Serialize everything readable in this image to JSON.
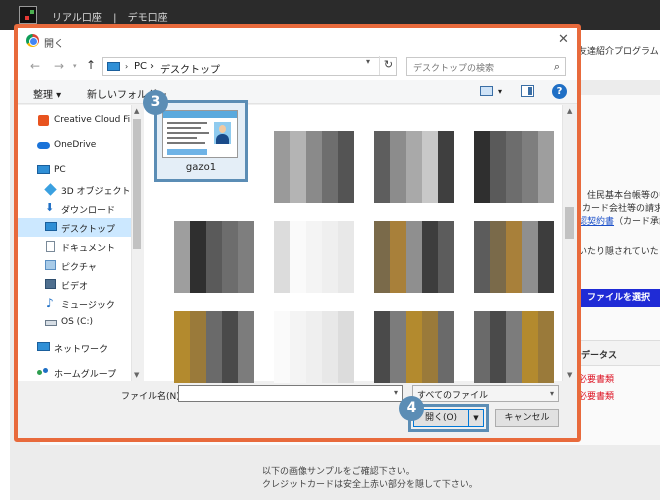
{
  "site": {
    "nav": [
      "リアル口座",
      "|",
      "デモ口座"
    ],
    "right_text_1": "友達紹介プログラム",
    "right_text_2": "、住民基本台帳等の中",
    "right_text_3": "カード会社等の請求書",
    "right_link": "認契約書",
    "right_text_4": "（カード承認",
    "right_text_5": "いたり隠されていたり",
    "upload_button": "ファイルを選択",
    "table_header": "データス",
    "required_1": "必要書類",
    "required_2": "必要書類",
    "bottom_line_1": "以下の画像サンプルをご確認下さい。",
    "bottom_line_2": "クレジットカードは安全上赤い部分を隠して下さい。"
  },
  "dialog": {
    "title": "開く",
    "breadcrumb": [
      "PC",
      "›",
      "デスクトップ"
    ],
    "search_placeholder": "デスクトップの検索",
    "toolbar": {
      "organize": "整理 ▾",
      "new_folder": "新しいフォルダー"
    },
    "nav_tree": [
      {
        "label": "Creative Cloud File",
        "icon": "creative-cloud-icon",
        "color": "#e8531f"
      },
      {
        "label": "OneDrive",
        "icon": "onedrive-icon",
        "color": "#1a73d9"
      },
      {
        "label": "PC",
        "icon": "pc-icon",
        "color": "#2f8fd6"
      },
      {
        "label": "3D オブジェクト",
        "icon": "3d-objects-icon",
        "color": "#3aa0e0"
      },
      {
        "label": "ダウンロード",
        "icon": "download-icon",
        "color": "#1f6fc5"
      },
      {
        "label": "デスクトップ",
        "icon": "desktop-icon",
        "color": "#2f8fd6",
        "selected": true
      },
      {
        "label": "ドキュメント",
        "icon": "documents-icon",
        "color": "#7a8a99"
      },
      {
        "label": "ピクチャ",
        "icon": "pictures-icon",
        "color": "#5a8fc2"
      },
      {
        "label": "ビデオ",
        "icon": "videos-icon",
        "color": "#4f6f8f"
      },
      {
        "label": "ミュージック",
        "icon": "music-icon",
        "color": "#1f6fc5"
      },
      {
        "label": "OS (C:)",
        "icon": "drive-icon",
        "color": "#6a7a8a"
      },
      {
        "label": "ネットワーク",
        "icon": "network-icon",
        "color": "#2f8fd6"
      },
      {
        "label": "ホームグループ",
        "icon": "homegroup-icon",
        "color": "#2e9e4f"
      }
    ],
    "selected_file": "gazo1",
    "file_name_label": "ファイル名(N):",
    "file_name_value": "",
    "file_type": "すべてのファイル",
    "open_button": "開く(O)",
    "cancel_button": "キャンセル"
  },
  "steps": {
    "three": "3",
    "four": "4"
  },
  "colors": {
    "highlight_frame": "#e86a3c",
    "step_badge": "#5b8db5",
    "site_button": "#1f2bd6"
  }
}
